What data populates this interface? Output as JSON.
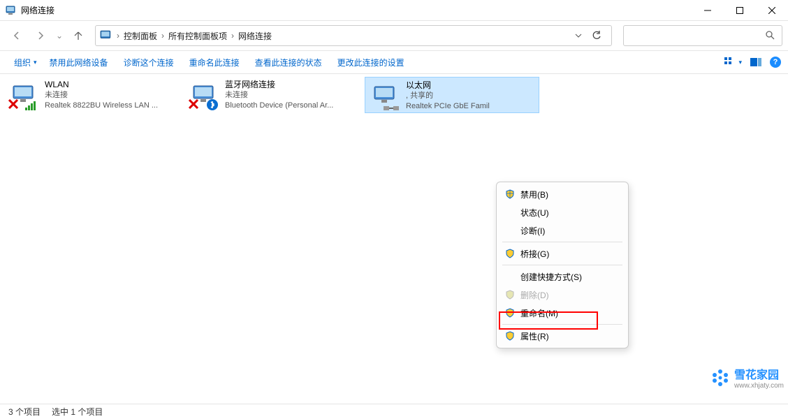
{
  "window": {
    "title": "网络连接"
  },
  "breadcrumb": {
    "seg1": "控制面板",
    "seg2": "所有控制面板项",
    "seg3": "网络连接"
  },
  "toolbar": {
    "organize": "组织",
    "disable": "禁用此网络设备",
    "diagnose": "诊断这个连接",
    "rename": "重命名此连接",
    "viewstatus": "查看此连接的状态",
    "changesettings": "更改此连接的设置"
  },
  "adapters": [
    {
      "name": "WLAN",
      "status": "未连接",
      "device": "Realtek 8822BU Wireless LAN ..."
    },
    {
      "name": "蓝牙网络连接",
      "status": "未连接",
      "device": "Bluetooth Device (Personal Ar..."
    },
    {
      "name": "以太网",
      "status": ", 共享的",
      "device": "Realtek PCIe GbE Famil"
    }
  ],
  "context_menu": {
    "disable": "禁用(B)",
    "status": "状态(U)",
    "diagnose": "诊断(I)",
    "bridge": "桥接(G)",
    "shortcut": "创建快捷方式(S)",
    "delete": "删除(D)",
    "rename": "重命名(M)",
    "properties": "属性(R)"
  },
  "statusbar": {
    "count": "3 个项目",
    "selected": "选中 1 个项目"
  },
  "watermark": {
    "name": "雪花家园",
    "url": "www.xhjaty.com"
  }
}
